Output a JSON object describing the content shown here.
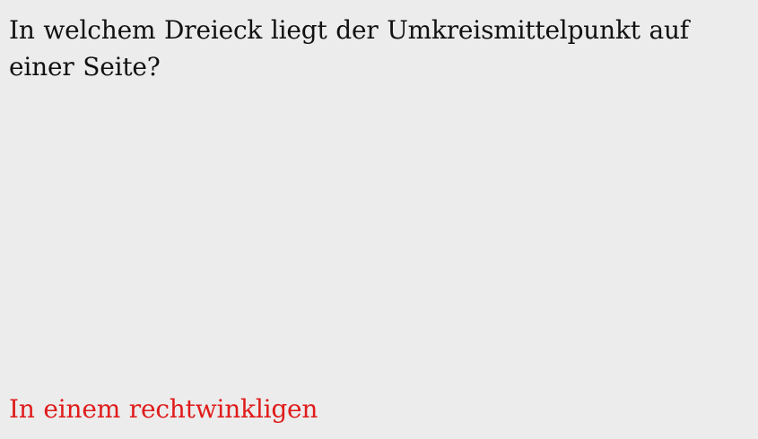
{
  "card": {
    "question": "In welchem Dreieck liegt der Umkreismittelpunkt auf einer Seite?",
    "answer": "In einem rechtwinkligen"
  },
  "colors": {
    "background": "#ececec",
    "question_text": "#111111",
    "answer_text": "#e01b1b"
  }
}
